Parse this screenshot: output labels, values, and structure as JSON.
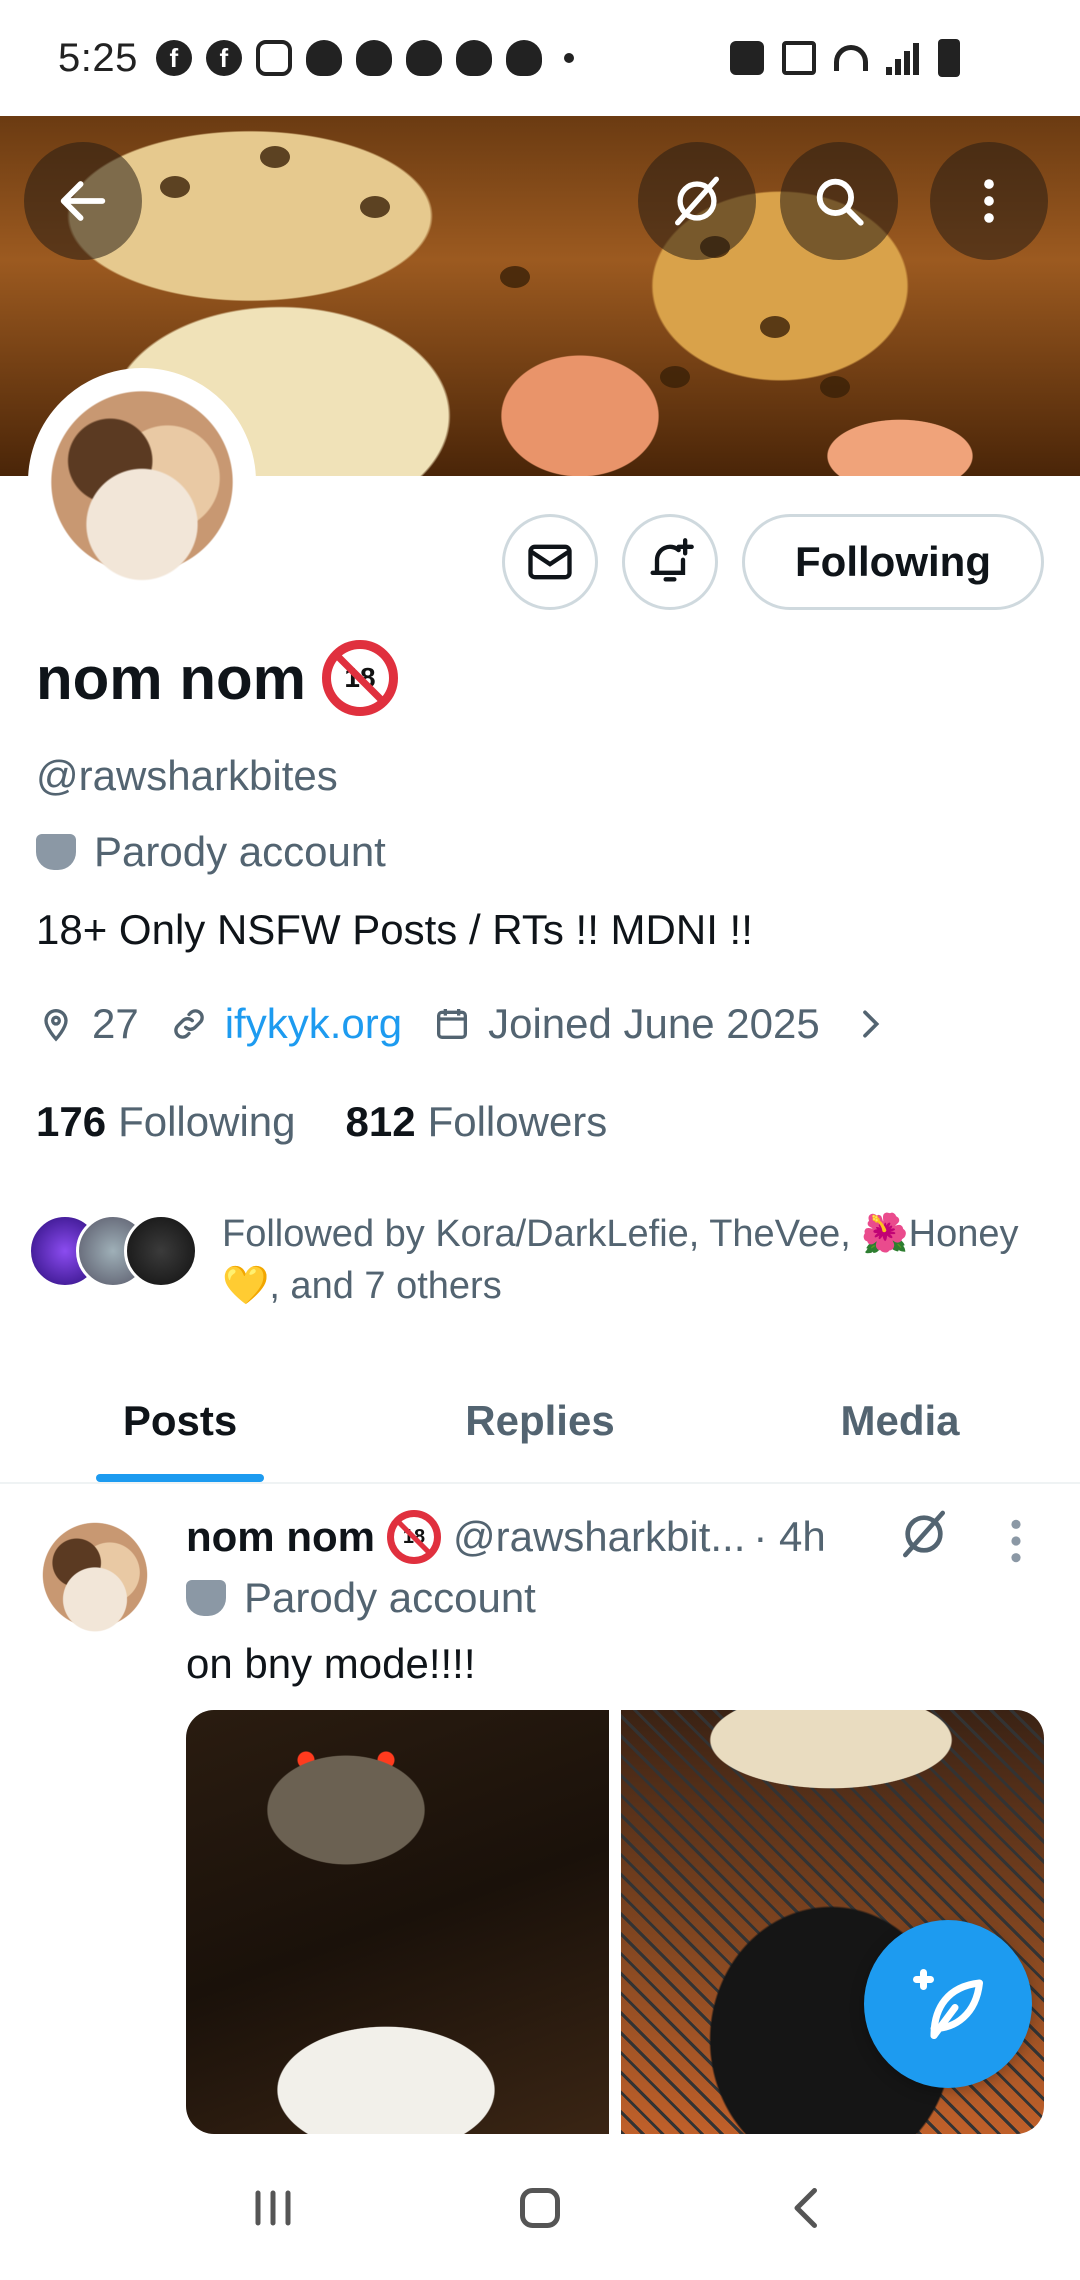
{
  "status_bar": {
    "time": "5:25"
  },
  "profile": {
    "name": "nom nom",
    "badge": "18",
    "handle": "@rawsharkbites",
    "parody_label": "Parody account",
    "bio": "18+ Only NSFW Posts / RTs !! MDNI !!",
    "location": "27",
    "website": "ifykyk.org",
    "joined": "Joined June 2025",
    "following_count": "176",
    "following_label": "Following",
    "followers_count": "812",
    "followers_label": "Followers",
    "followed_by": "Followed by Kora/DarkLefie, TheVee, 🌺Honey 💛, and 7 others"
  },
  "actions": {
    "follow_button": "Following"
  },
  "tabs": [
    {
      "label": "Posts",
      "active": true
    },
    {
      "label": "Replies",
      "active": false
    },
    {
      "label": "Media",
      "active": false
    }
  ],
  "post": {
    "name": "nom nom",
    "handle": "@rawsharkbit...",
    "time": "· 4h",
    "parody_label": "Parody account",
    "text": "on bny mode!!!!"
  },
  "colors": {
    "accent": "#1d9bf0",
    "muted": "#536471",
    "text": "#0f1419",
    "badge_red": "#e0303e"
  },
  "icons": [
    "back-arrow-icon",
    "grok-icon",
    "search-icon",
    "more-vertical-icon",
    "mail-icon",
    "bell-plus-icon",
    "location-pin-icon",
    "link-icon",
    "calendar-icon",
    "chevron-right-icon",
    "mask-icon",
    "compose-icon",
    "recents-icon",
    "home-icon",
    "back-icon"
  ]
}
